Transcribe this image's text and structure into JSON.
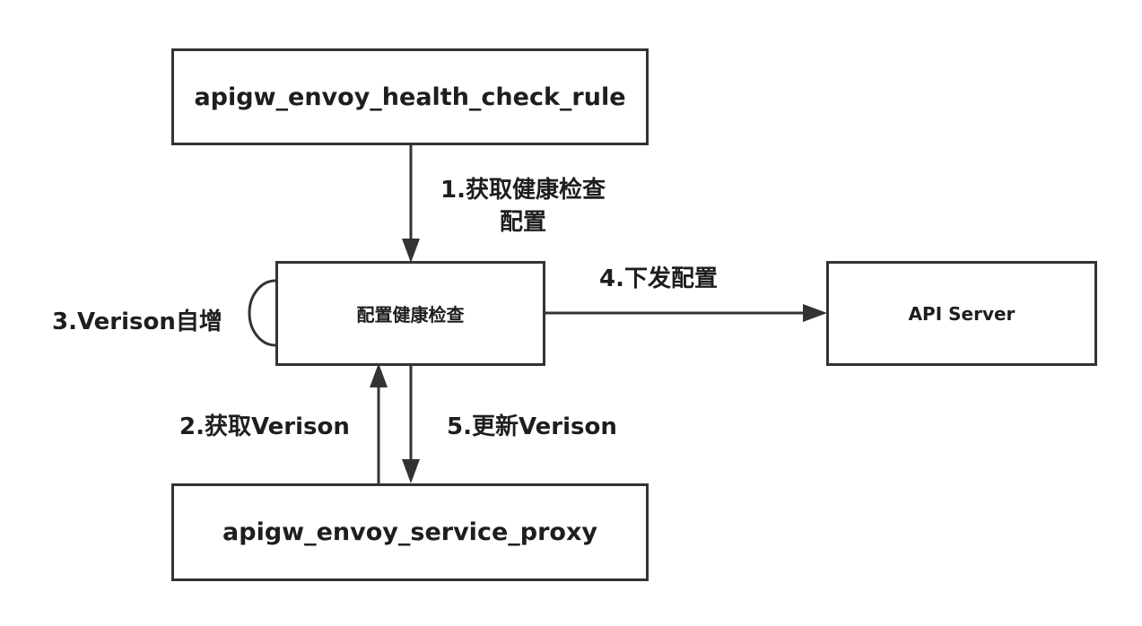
{
  "boxes": {
    "rule": "apigw_envoy_health_check_rule",
    "check": "配置健康检查",
    "api": "API Server",
    "proxy": "apigw_envoy_service_proxy"
  },
  "labels": {
    "step1_line1": "1.获取健康检查",
    "step1_line2": "配置",
    "step2": "2.获取Verison",
    "step3": "3.Verison自增",
    "step4": "4.下发配置",
    "step5": "5.更新Verison"
  }
}
